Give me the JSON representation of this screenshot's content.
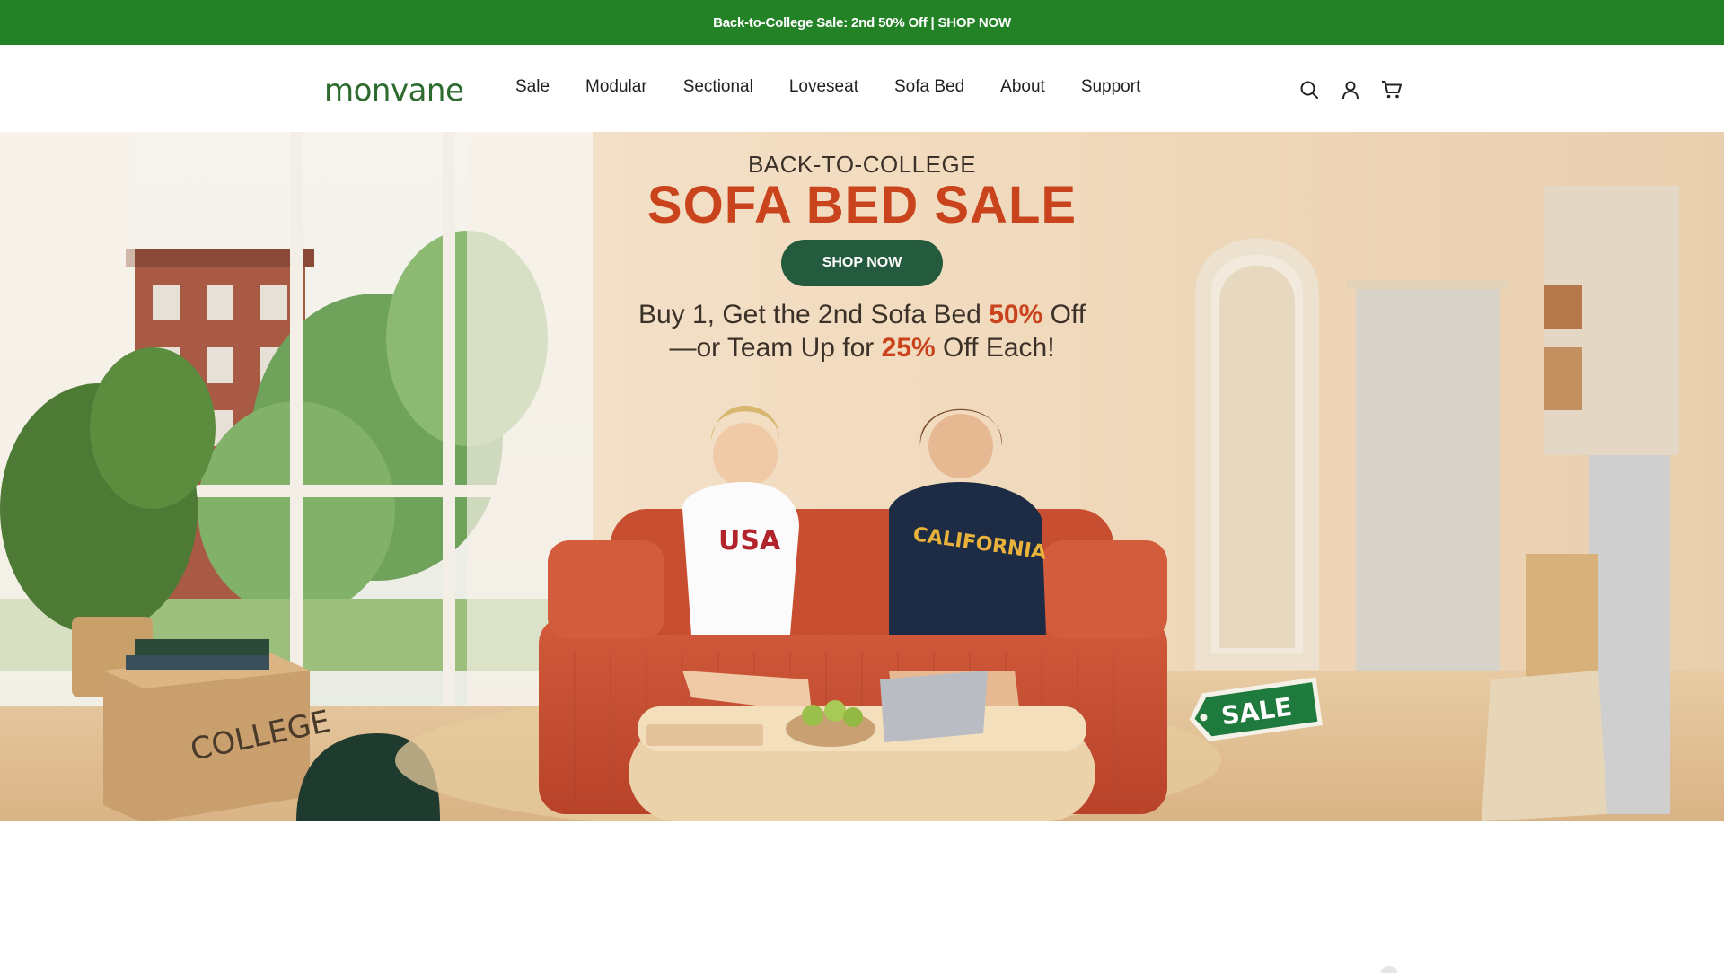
{
  "announcement": {
    "text": "Back-to-College Sale: 2nd 50% Off | SHOP NOW"
  },
  "header": {
    "logo": "monvane",
    "nav": [
      "Sale",
      "Modular",
      "Sectional",
      "Loveseat",
      "Sofa Bed",
      "About",
      "Support"
    ],
    "icons": [
      "search-icon",
      "account-icon",
      "cart-icon"
    ]
  },
  "hero": {
    "eyebrow": "BACK-TO-COLLEGE",
    "title": "SOFA BED SALE",
    "cta": "SHOP NOW",
    "offer": {
      "line1_prefix": "Buy 1, Get the 2nd Sofa Bed ",
      "line1_highlight": "50%",
      "line1_suffix": " Off",
      "line2_prefix": "—or Team Up for ",
      "line2_highlight": "25%",
      "line2_suffix": " Off Each!"
    },
    "box_text": "COLLEGE",
    "shirt_left": "USA",
    "shirt_right": "CALIFORNIA",
    "sale_tag": "SALE"
  },
  "colors": {
    "announcement_bg": "#238126",
    "logo": "#2e6b2f",
    "cta_bg": "#245a3d",
    "accent": "#c9431d"
  }
}
